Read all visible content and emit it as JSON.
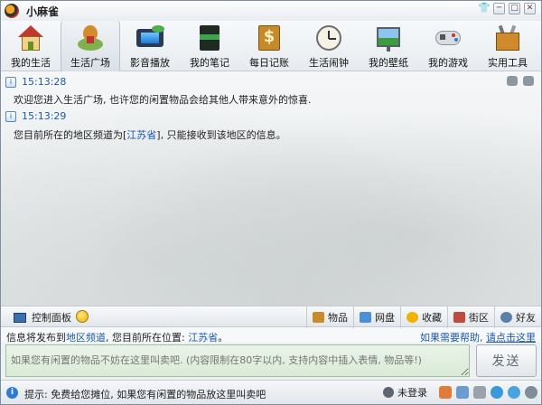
{
  "app": {
    "title": "小麻雀"
  },
  "window_controls": {
    "skin": "👕",
    "minimize": "─",
    "maximize": "□",
    "close": "✕"
  },
  "toolbar": {
    "items": [
      {
        "label": "我的生活",
        "icon": "house-icon"
      },
      {
        "label": "生活广场",
        "icon": "plaza-icon",
        "active": true
      },
      {
        "label": "影音播放",
        "icon": "film-icon"
      },
      {
        "label": "我的笔记",
        "icon": "notebook-icon"
      },
      {
        "label": "每日记账",
        "icon": "ledger-icon"
      },
      {
        "label": "生活闹钟",
        "icon": "clock-icon"
      },
      {
        "label": "我的壁纸",
        "icon": "wallpaper-icon"
      },
      {
        "label": "我的游戏",
        "icon": "gamepad-icon"
      },
      {
        "label": "实用工具",
        "icon": "toolbox-icon"
      }
    ]
  },
  "messages": [
    {
      "time": "15:13:28",
      "text": "欢迎您进入生活广场, 也许您的闲置物品会给其他人带来意外的惊喜."
    },
    {
      "time": "15:13:29",
      "text_before": "您目前所在的地区频道为[",
      "location": "江苏省",
      "text_after": "], 只能接收到该地区的信息。"
    }
  ],
  "tabstrip": {
    "control_panel": "控制面板",
    "tabs": [
      {
        "label": "物品",
        "icon": "goods-icon",
        "color": "#c88a2a"
      },
      {
        "label": "网盘",
        "icon": "netdisk-icon",
        "color": "#4a8fd8"
      },
      {
        "label": "收藏",
        "icon": "star-icon",
        "color": "#f0b400"
      },
      {
        "label": "街区",
        "icon": "street-icon",
        "color": "#c24a3a"
      },
      {
        "label": "好友",
        "icon": "friends-icon",
        "color": "#5a7fa8"
      }
    ]
  },
  "info": {
    "prefix": "信息将发布到",
    "channel": "地区频道",
    "middle": ", 您目前所在位置: ",
    "location": "江苏省",
    "suffix": "。",
    "help_prefix": "如果需要帮助, ",
    "help_link": "请点击这里"
  },
  "input": {
    "placeholder": "如果您有闲置的物品不妨在这里叫卖吧. (内容限制在80字以内, 支持内容中插入表情, 物品等!)",
    "send": "发送"
  },
  "statusbar": {
    "tip": "提示: 免费给您摊位, 如果您有闲置的物品放这里叫卖吧",
    "login": "未登录"
  }
}
